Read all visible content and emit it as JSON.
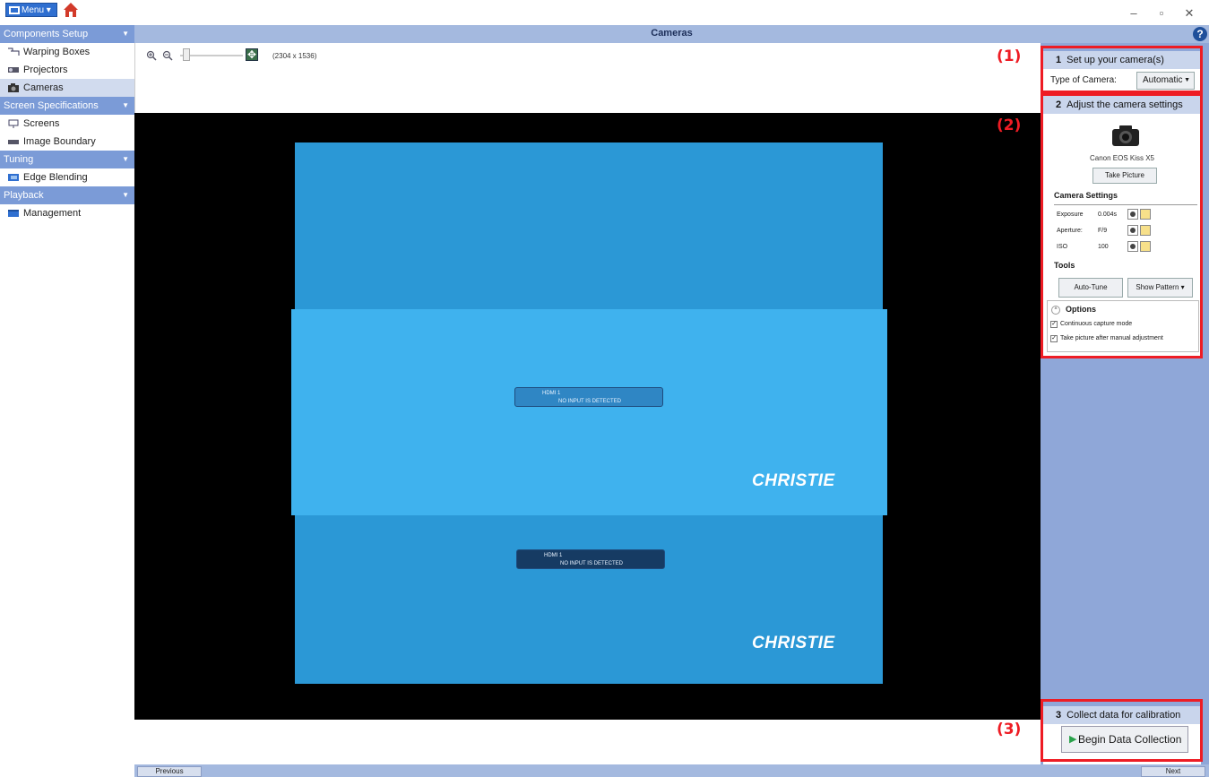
{
  "app": {
    "menu_label": "Menu ▾",
    "window_title": "Cameras",
    "help_symbol": "?",
    "window_controls": {
      "minimize": "–",
      "maximize": "▫",
      "close": "✕"
    }
  },
  "sidebar": {
    "sections": [
      {
        "header": "Components Setup",
        "items": [
          {
            "label": "Warping Boxes",
            "icon": "warping-boxes-icon"
          },
          {
            "label": "Projectors",
            "icon": "projector-icon"
          },
          {
            "label": "Cameras",
            "icon": "camera-icon",
            "active": true
          }
        ]
      },
      {
        "header": "Screen Specifications",
        "items": [
          {
            "label": "Screens",
            "icon": "screen-icon"
          },
          {
            "label": "Image Boundary",
            "icon": "image-boundary-icon"
          }
        ]
      },
      {
        "header": "Tuning",
        "items": [
          {
            "label": "Edge Blending",
            "icon": "edge-blending-icon"
          }
        ]
      },
      {
        "header": "Playback",
        "items": [
          {
            "label": "Management",
            "icon": "management-icon"
          }
        ]
      }
    ]
  },
  "toolbar": {
    "resolution": "(2304 x 1536)"
  },
  "viewer": {
    "osd_source": "HDMI 1",
    "osd_message": "NO INPUT IS DETECTED",
    "brand_text": "CHRISTIE"
  },
  "panel": {
    "step1": {
      "number": "1",
      "title": "Set up your camera(s)",
      "type_label": "Type of Camera:",
      "type_value": "Automatic"
    },
    "step2": {
      "number": "2",
      "title": "Adjust the camera settings",
      "camera_model": "Canon EOS Kiss X5",
      "take_picture": "Take Picture",
      "camera_settings_title": "Camera Settings",
      "settings": [
        {
          "name": "Exposure",
          "value": "0.004s"
        },
        {
          "name": "Aperture:",
          "value": "F/9"
        },
        {
          "name": "ISO",
          "value": "100"
        }
      ],
      "tools_title": "Tools",
      "auto_tune": "Auto-Tune",
      "show_pattern": "Show Pattern ▾",
      "options_title": "Options",
      "options": [
        {
          "label": "Continuous capture mode",
          "checked": true
        },
        {
          "label": "Take picture after manual adjustment",
          "checked": true
        }
      ]
    },
    "step3": {
      "number": "3",
      "title": "Collect data for calibration",
      "begin_label": "Begin Data Collection"
    }
  },
  "nav": {
    "previous": "Previous",
    "next": "Next"
  },
  "annotations": {
    "label1": "(1)",
    "label2": "(2)",
    "label3": "(3)"
  },
  "colors": {
    "accent_red": "#ee1c24",
    "sidebar_header": "#7b9bd7",
    "title_bar": "#a4b9df",
    "panel_bg": "#8fa7d8"
  }
}
